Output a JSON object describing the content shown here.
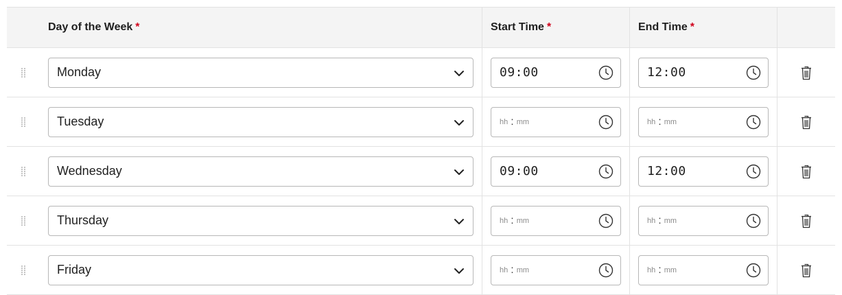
{
  "header": {
    "day_label": "Day of the Week",
    "start_label": "Start Time",
    "end_label": "End Time",
    "required_mark": "*"
  },
  "placeholder": {
    "hh": "hh",
    "sep": ":",
    "mm": "mm"
  },
  "rows": [
    {
      "day": "Monday",
      "start": "09:00",
      "end": "12:00"
    },
    {
      "day": "Tuesday",
      "start": "",
      "end": ""
    },
    {
      "day": "Wednesday",
      "start": "09:00",
      "end": "12:00"
    },
    {
      "day": "Thursday",
      "start": "",
      "end": ""
    },
    {
      "day": "Friday",
      "start": "",
      "end": ""
    }
  ],
  "icons": {
    "drag": "drag-handle-icon",
    "chevron": "chevron-down-icon",
    "clock": "clock-icon",
    "delete": "trash-icon"
  }
}
